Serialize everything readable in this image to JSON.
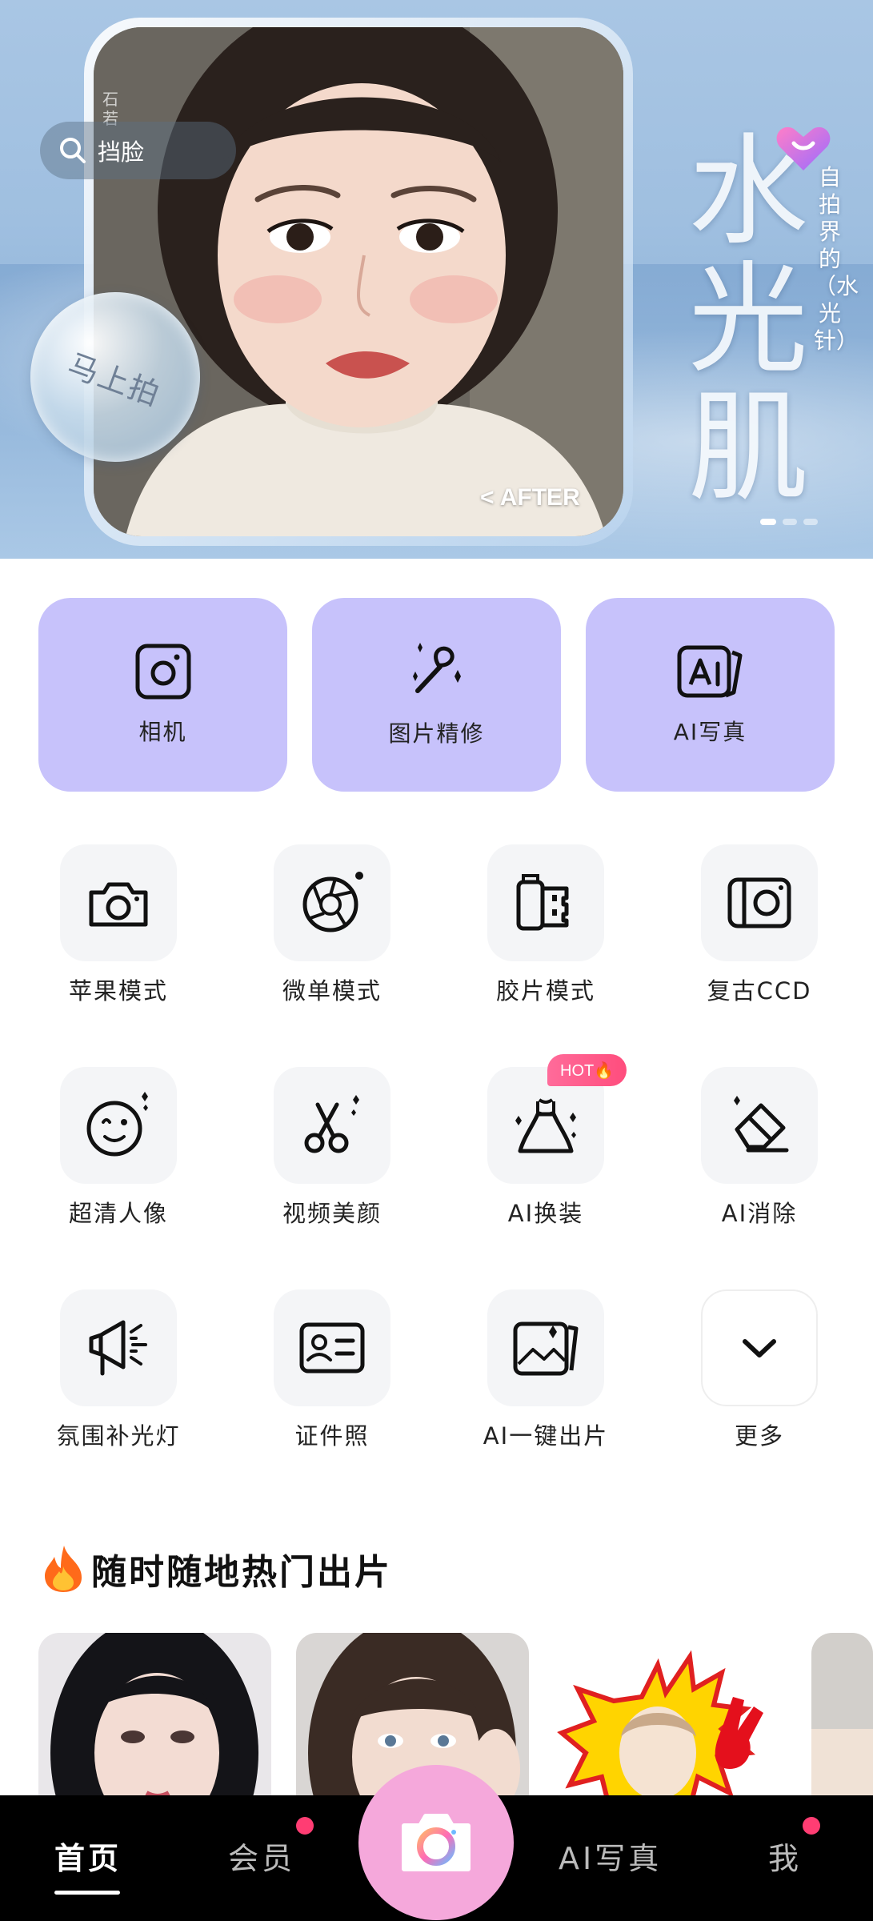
{
  "banner": {
    "search_label": "挡脸",
    "watermark": "石若",
    "shoot_label": "马上拍",
    "after_label": "< AFTER",
    "headline": "水光肌",
    "subline": "自拍界的（水光针）"
  },
  "big_cards": [
    {
      "label": "相机",
      "icon": "camera-square-icon"
    },
    {
      "label": "图片精修",
      "icon": "makeup-brush-icon"
    },
    {
      "label": "AI写真",
      "icon": "ai-photo-icon"
    }
  ],
  "tools": [
    {
      "label": "苹果模式",
      "icon": "camera-icon"
    },
    {
      "label": "微单模式",
      "icon": "aperture-icon"
    },
    {
      "label": "胶片模式",
      "icon": "film-roll-icon"
    },
    {
      "label": "复古CCD",
      "icon": "ccd-camera-icon"
    },
    {
      "label": "超清人像",
      "icon": "wink-face-icon"
    },
    {
      "label": "视频美颜",
      "icon": "scissors-icon"
    },
    {
      "label": "AI换装",
      "icon": "dress-icon",
      "badge": "HOT🔥"
    },
    {
      "label": "AI消除",
      "icon": "eraser-icon"
    },
    {
      "label": "氛围补光灯",
      "icon": "fill-light-icon"
    },
    {
      "label": "证件照",
      "icon": "id-card-icon"
    },
    {
      "label": "AI一键出片",
      "icon": "gallery-icon"
    },
    {
      "label": "更多",
      "icon": "chevron-down-icon"
    }
  ],
  "section": {
    "title": "随时随地热门出片",
    "icon": "fire-icon"
  },
  "bottom_nav": {
    "items": [
      "首页",
      "会员",
      "AI写真",
      "我"
    ],
    "active": "首页"
  },
  "colors": {
    "card_bg": "#c7c2fb",
    "tile_bg": "#f4f5f7",
    "nav_bg": "#000000",
    "camera_button": "#f5a8db",
    "notification_dot": "#ff3d73"
  }
}
